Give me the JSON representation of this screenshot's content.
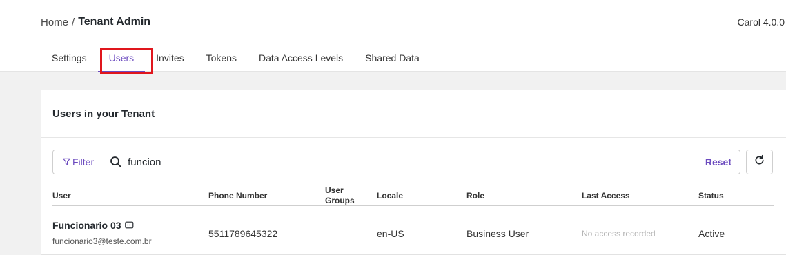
{
  "breadcrumb": {
    "home": "Home",
    "separator": "/",
    "current": "Tenant Admin"
  },
  "version": "Carol 4.0.0",
  "tabs": [
    {
      "label": "Settings",
      "active": false
    },
    {
      "label": "Users",
      "active": true
    },
    {
      "label": "Invites",
      "active": false
    },
    {
      "label": "Tokens",
      "active": false
    },
    {
      "label": "Data Access Levels",
      "active": false
    },
    {
      "label": "Shared Data",
      "active": false
    }
  ],
  "card": {
    "title": "Users in your Tenant"
  },
  "search": {
    "filter_label": "Filter",
    "value": "funcion",
    "reset_label": "Reset"
  },
  "table": {
    "headers": {
      "user": "User",
      "phone": "Phone Number",
      "groups_line1": "User",
      "groups_line2": "Groups",
      "locale": "Locale",
      "role": "Role",
      "last_access": "Last Access",
      "status": "Status"
    },
    "rows": [
      {
        "name": "Funcionario 03",
        "email": "funcionario3@teste.com.br",
        "phone": "5511789645322",
        "groups": "",
        "locale": "en-US",
        "role": "Business User",
        "last_access": "No access recorded",
        "status": "Active"
      }
    ]
  },
  "colors": {
    "accent": "#6c4bbf",
    "highlight": "#e0161d"
  }
}
